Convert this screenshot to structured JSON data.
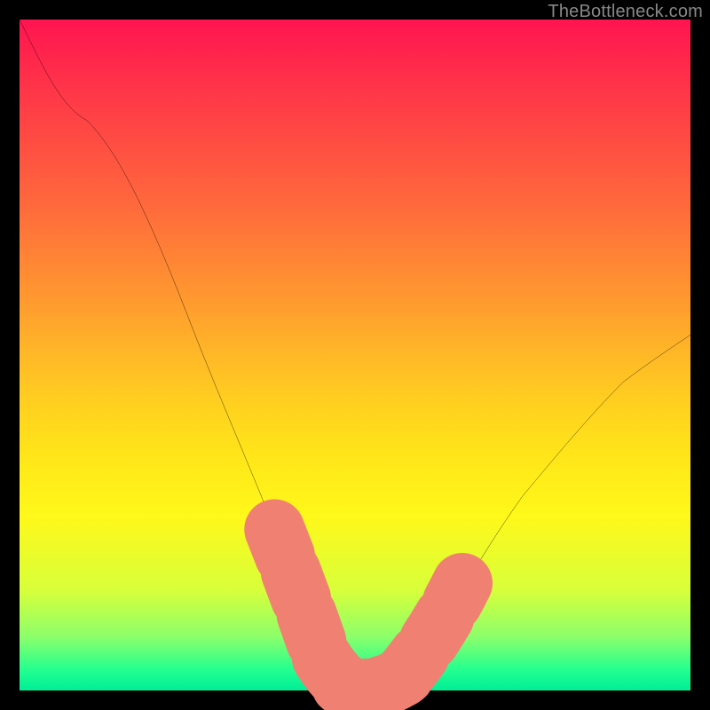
{
  "watermark": "TheBottleneck.com",
  "chart_data": {
    "type": "line",
    "title": "",
    "xlabel": "",
    "ylabel": "",
    "xlim": [
      0,
      100
    ],
    "ylim": [
      0,
      100
    ],
    "grid": false,
    "note": "Gradient background: red=high bottleneck at top, green=low bottleneck at bottom. Black curve is the bottleneck magnitude; salmon dashed overlay marks the near-optimal band.",
    "series": [
      {
        "name": "bottleneck-curve",
        "color": "#000000",
        "x": [
          0,
          5,
          10,
          15,
          20,
          25,
          30,
          35,
          40,
          42,
          45,
          48,
          50,
          52,
          55,
          58,
          60,
          63,
          65,
          70,
          75,
          80,
          85,
          90,
          95,
          100
        ],
        "values": [
          100,
          94,
          85,
          76,
          66,
          56,
          45,
          33,
          19,
          11,
          4,
          1,
          0,
          0,
          1,
          3,
          6,
          10,
          14,
          22,
          29,
          35,
          41,
          46,
          50,
          53
        ]
      },
      {
        "name": "optimal-band",
        "style": "dashed",
        "color": "#f08072",
        "stroke_width": 9,
        "x": [
          38,
          40,
          42,
          44,
          46,
          48,
          50,
          52,
          54,
          56,
          58,
          60,
          62,
          64,
          66
        ],
        "values": [
          24,
          19,
          11,
          6,
          3,
          1,
          0,
          0,
          1,
          2,
          3,
          6,
          9,
          12,
          16
        ]
      }
    ]
  }
}
